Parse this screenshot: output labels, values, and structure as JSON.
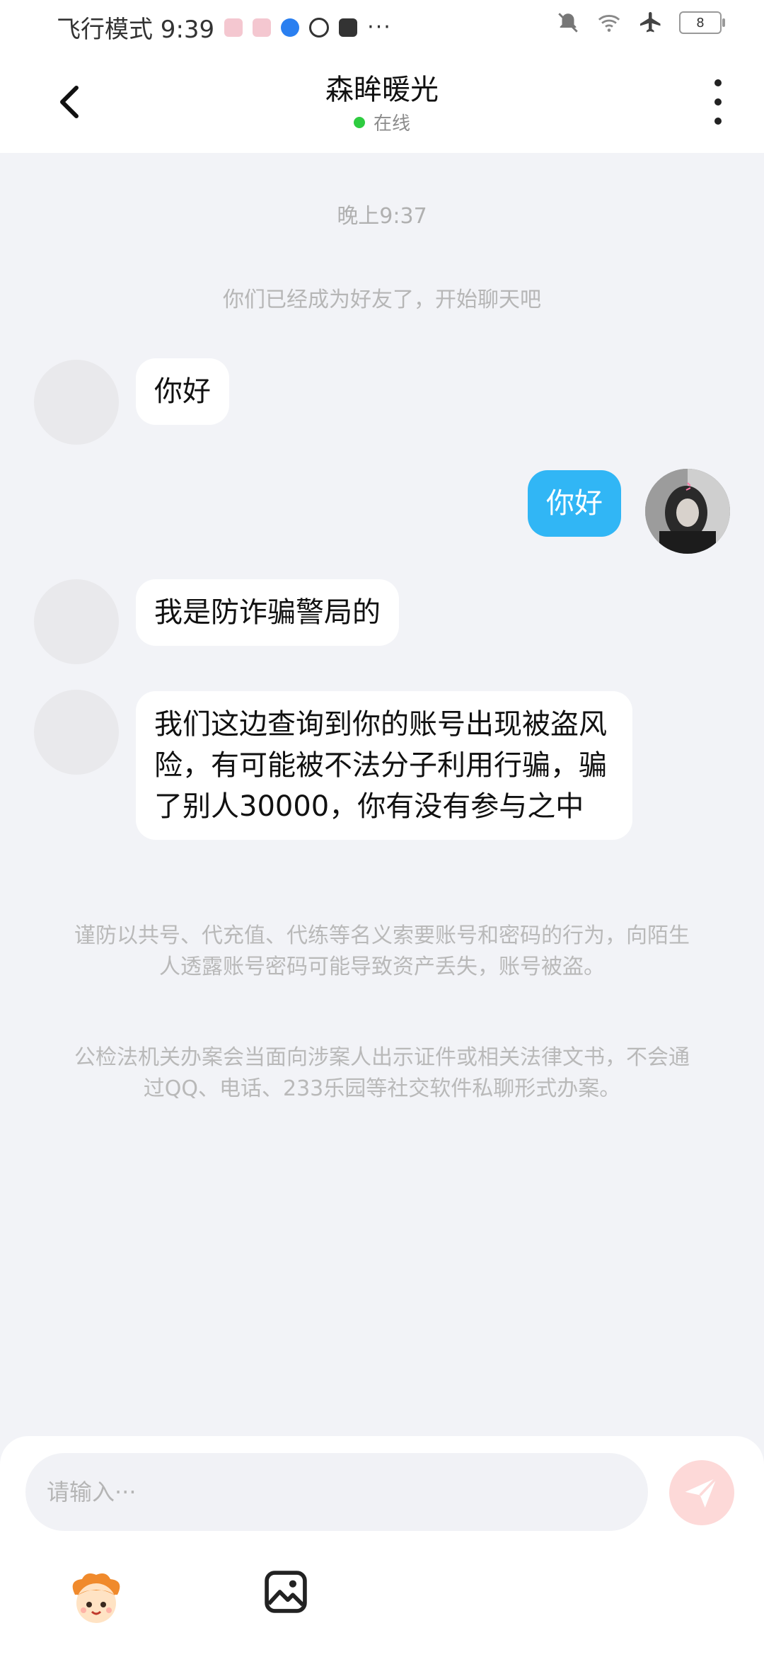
{
  "status_bar": {
    "left_text": "飞行模式 9:39",
    "dots": "···",
    "battery": "8"
  },
  "header": {
    "title": "森眸暖光",
    "status": "在线"
  },
  "chat": {
    "time": "晚上9:37",
    "system": "你们已经成为好友了，开始聊天吧",
    "messages": [
      {
        "sender": "other",
        "text": "你好"
      },
      {
        "sender": "me",
        "text": "你好"
      },
      {
        "sender": "other",
        "text": "我是防诈骗警局的"
      },
      {
        "sender": "other",
        "text": "我们这边查询到你的账号出现被盗风险，有可能被不法分子利用行骗，骗了别人30000，你有没有参与之中"
      }
    ],
    "notice1": "谨防以共号、代充值、代练等名义索要账号和密码的行为，向陌生人透露账号密码可能导致资产丢失，账号被盗。",
    "notice2": "公检法机关办案会当面向涉案人出示证件或相关法律文书，不会通过QQ、电话、233乐园等社交软件私聊形式办案。"
  },
  "composer": {
    "placeholder": "请输入···"
  },
  "colors": {
    "accent_blue": "#31b6f5",
    "online_green": "#2ecc40",
    "send_disabled": "#fdd9d8"
  },
  "icons": [
    "back-arrow-icon",
    "more-vertical-icon",
    "send-icon",
    "emoji-mascot-icon",
    "image-icon",
    "mute-icon",
    "wifi-icon",
    "airplane-icon"
  ]
}
